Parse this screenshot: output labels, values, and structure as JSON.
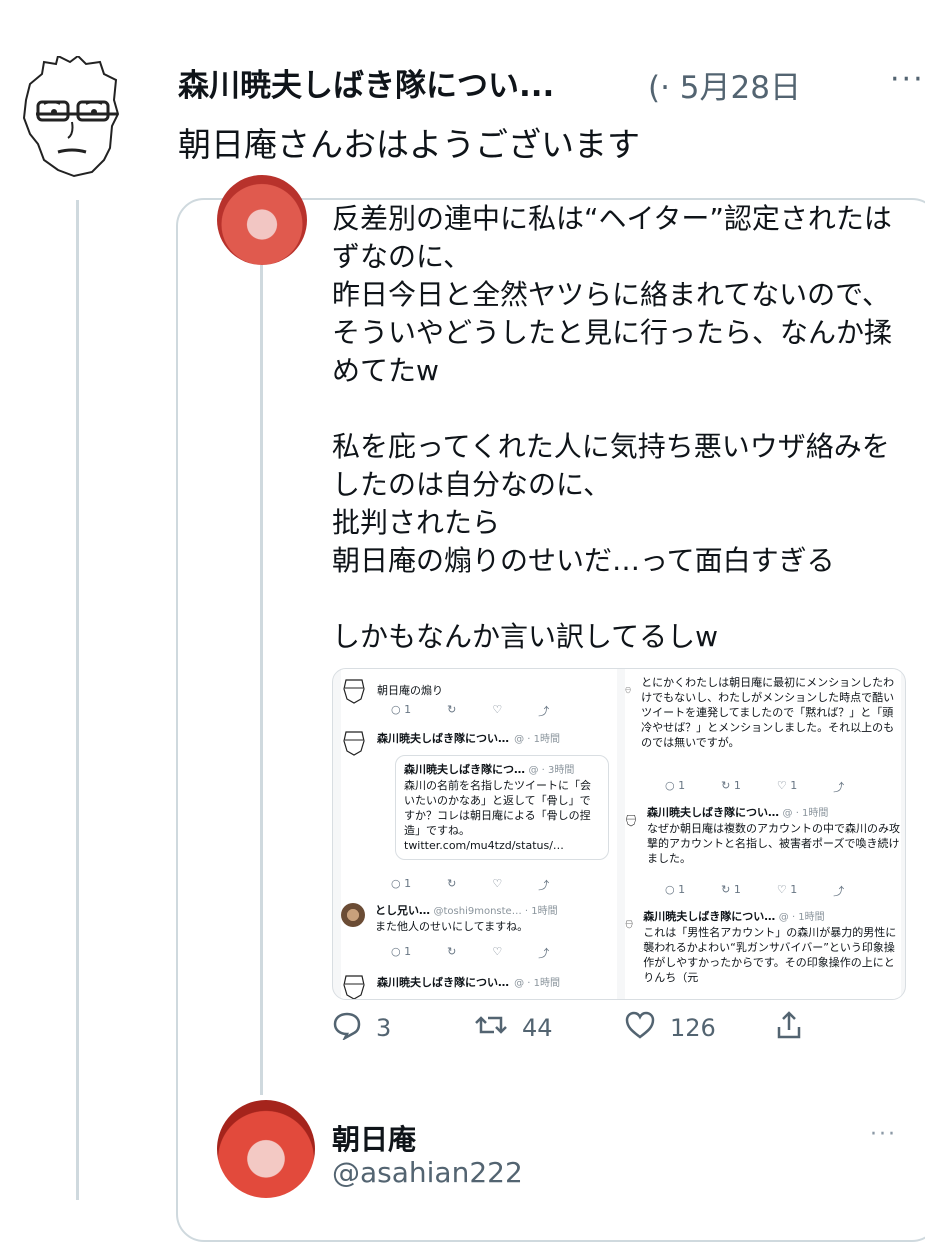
{
  "tweet": {
    "author": "森川暁夫しばき隊につい...",
    "meta": "(· 5月28日",
    "more": "···",
    "text": "朝日庵さんおはようございます"
  },
  "quoted": {
    "paragraph1": "反差別の連中に私は“ヘイター”認定されたはずなのに、\n昨日今日と全然ヤツらに絡まれてないので、\nそういやどうしたと見に行ったら、なんか揉めてたw",
    "paragraph2": "私を庇ってくれた人に気持ち悪いウザ絡みをしたのは自分なのに、\n批判されたら\n朝日庵の煽りのせいだ…って面白すぎる",
    "paragraph3": "しかもなんか言い訳してるしw",
    "screenshot": {
      "left": {
        "top_text": "朝日庵の煽り",
        "actions1": [
          "1",
          "",
          "",
          ""
        ],
        "name1": "森川暁夫しばき隊につい…",
        "meta1": "@ · 1時間",
        "quote_name": "森川暁夫しばき隊につ…",
        "quote_meta": "@ · 3時間",
        "quote_text": "森川の名前を名指したツイートに「会いたいのかなあ」と返して「骨し」ですか？コレは朝日庵による「骨しの捏造」ですね。",
        "quote_link": "twitter.com/mu4tzd/status/…",
        "actions2": [
          "1",
          "",
          "",
          ""
        ],
        "name2": "とし兄い…",
        "meta2": "@toshi9monste… · 1時間",
        "text2": "また他人のせいにしてますね。",
        "actions3": [
          "1",
          "",
          "",
          ""
        ],
        "name3": "森川暁夫しばき隊につい…",
        "meta3": "@ · 1時間"
      },
      "right": {
        "text1": "とにかくわたしは朝日庵に最初にメンションしたわけでもないし、わたしがメンションした時点で酷いツイートを連発してましたので「黙れば？」と「頭冷やせば？」とメンションしました。それ以上のものでは無いですが。",
        "actions1": [
          "1",
          "1",
          "1",
          ""
        ],
        "name1": "森川暁夫しばき隊につい…",
        "meta1": "@ · 1時間",
        "text2": "なぜか朝日庵は複数のアカウントの中で森川のみ攻撃的アカウントと名指し、被害者ポーズで喚き続けました。",
        "actions2": [
          "1",
          "1",
          "1",
          ""
        ],
        "name2": "森川暁夫しばき隊につい…",
        "meta2": "@ · 1時間",
        "text3": "これは「男性名アカウント」の森川が暴力的男性に襲われるかよわい“乳ガンサバイバー”という印象操作がしやすかったからです。その印象操作の上にとりんち（元"
      }
    },
    "actions": {
      "replies": "3",
      "retweets": "44",
      "likes": "126"
    }
  },
  "next_tweet": {
    "name": "朝日庵",
    "handle": "@asahian222",
    "more": "···"
  }
}
